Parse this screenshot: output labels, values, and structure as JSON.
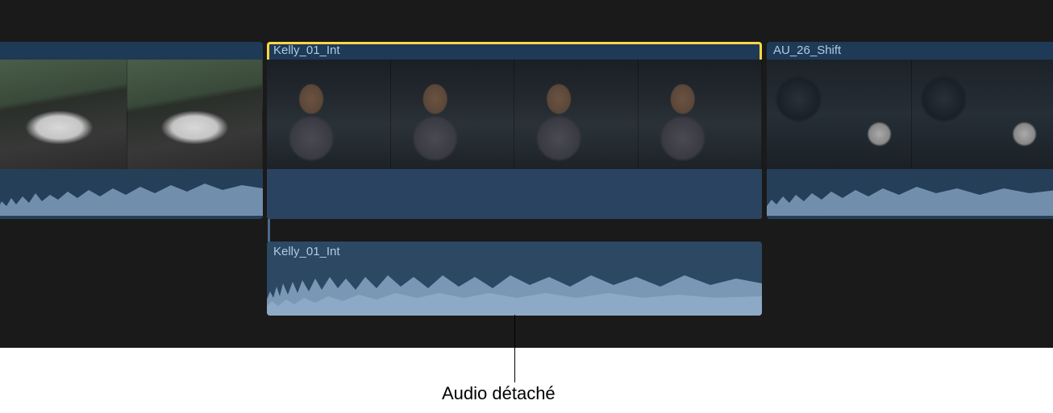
{
  "clips": {
    "clip1": {
      "name": ""
    },
    "clip2": {
      "name": "Kelly_01_Int",
      "selected": true
    },
    "clip3": {
      "name": "AU_26_Shift"
    }
  },
  "detachedAudio": {
    "name": "Kelly_01_Int"
  },
  "callout": {
    "label": "Audio détaché"
  }
}
